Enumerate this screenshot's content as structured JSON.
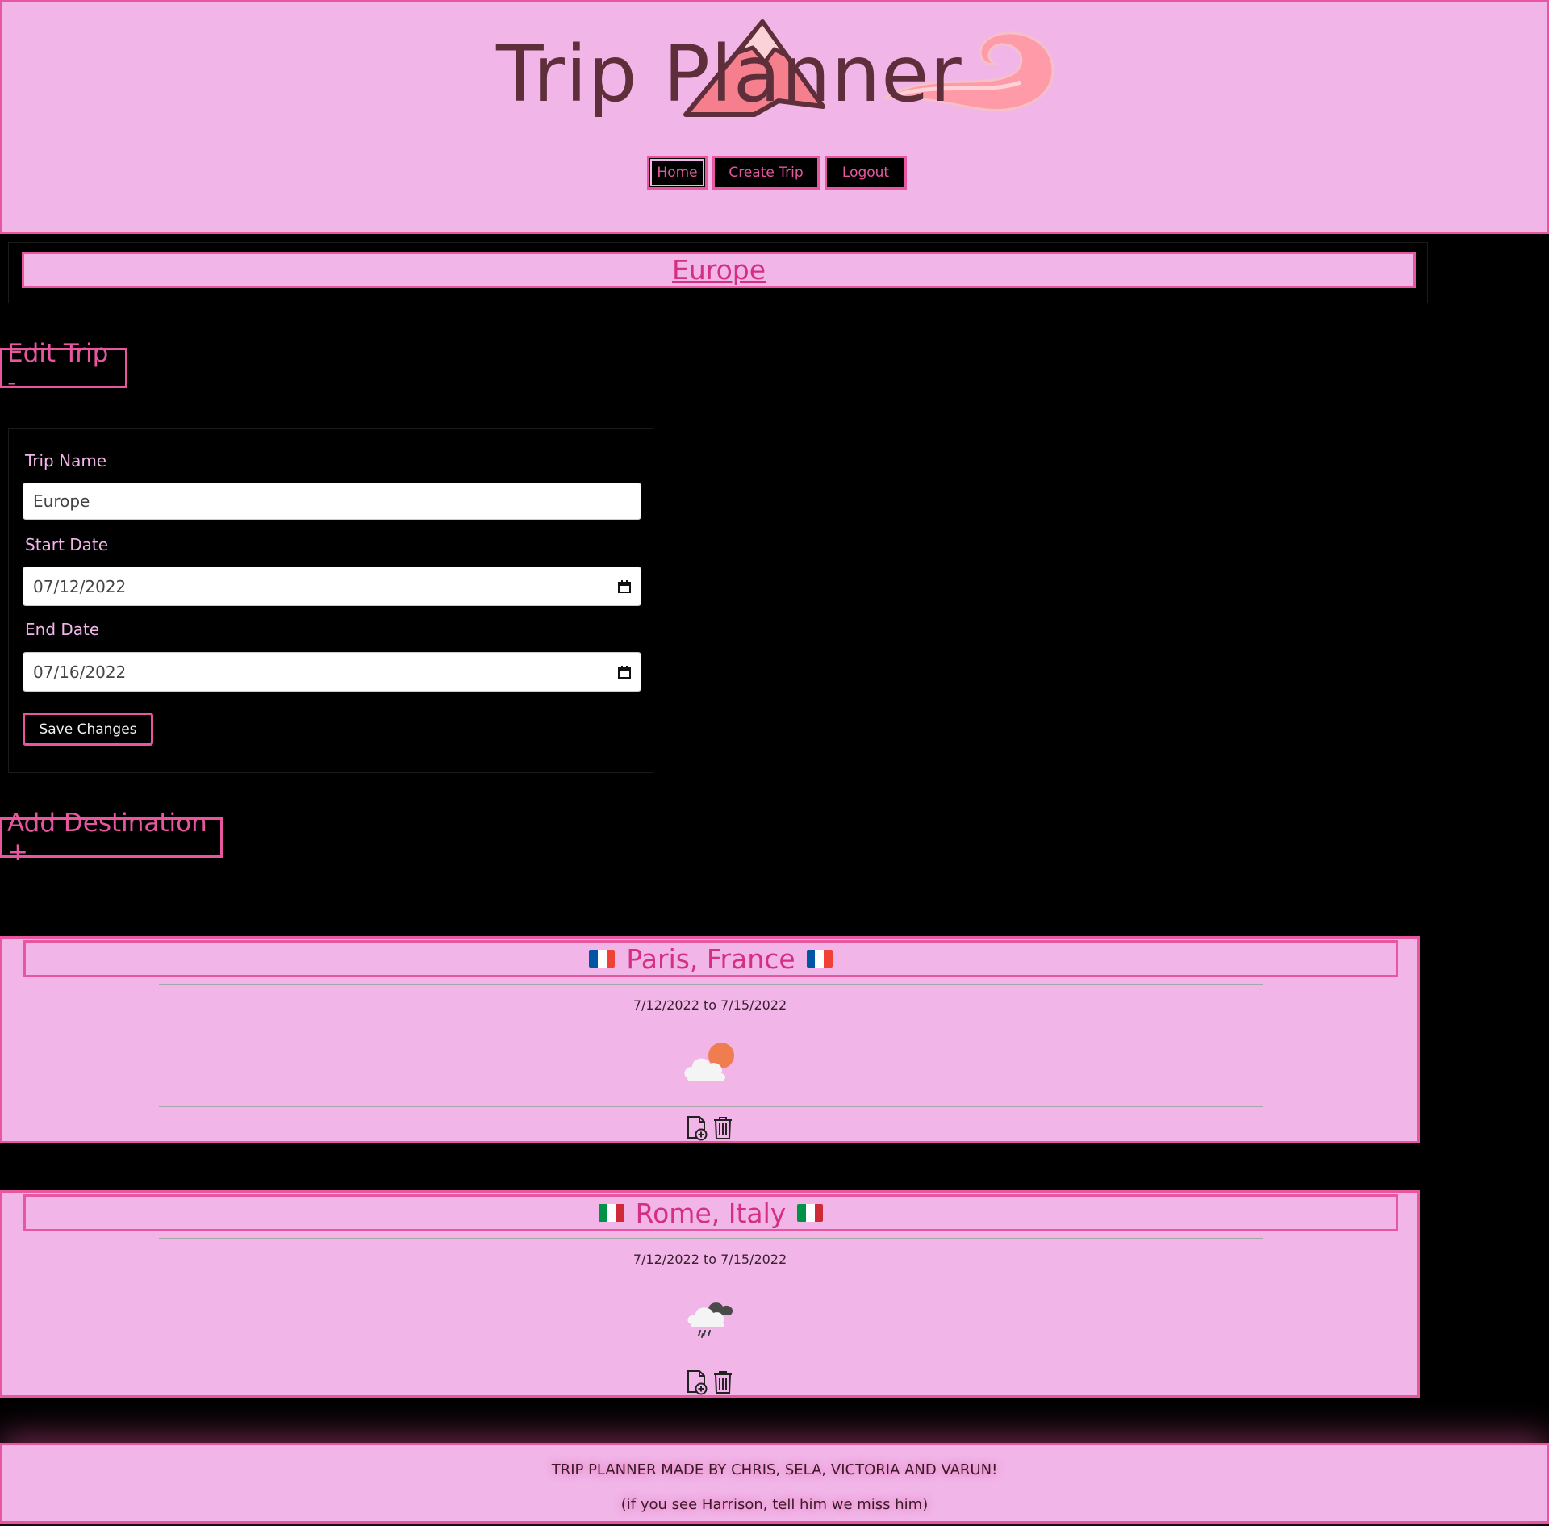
{
  "header": {
    "logo_text": "Trip Planner",
    "nav": {
      "home": "Home",
      "create_trip": "Create Trip",
      "logout": "Logout"
    }
  },
  "trip": {
    "title": "Europe"
  },
  "edit_section": {
    "heading": "Edit Trip -",
    "trip_name_label": "Trip Name",
    "trip_name_value": "Europe",
    "start_date_label": "Start Date",
    "start_date_value": "07/12/2022",
    "end_date_label": "End Date",
    "end_date_value": "07/16/2022",
    "save_label": "Save Changes"
  },
  "add_section": {
    "heading": "Add Destination +"
  },
  "destinations": [
    {
      "name": "Paris, France",
      "flag": "france-flag",
      "dates": "7/12/2022 to 7/15/2022",
      "weather_icon": "partly-cloudy-icon"
    },
    {
      "name": "Rome, Italy",
      "flag": "italy-flag",
      "dates": "7/12/2022 to 7/15/2022",
      "weather_icon": "rain-cloud-icon"
    }
  ],
  "footer": {
    "credits": "TRIP PLANNER MADE BY CHRIS, SELA, VICTORIA AND VARUN!",
    "note": "(if you see Harrison, tell him we miss him)"
  },
  "colors": {
    "page_background": "#000000",
    "panel_pink": "#f1b5e8",
    "accent_pink": "#e8569f",
    "logo_brown": "#5e2f3b"
  }
}
